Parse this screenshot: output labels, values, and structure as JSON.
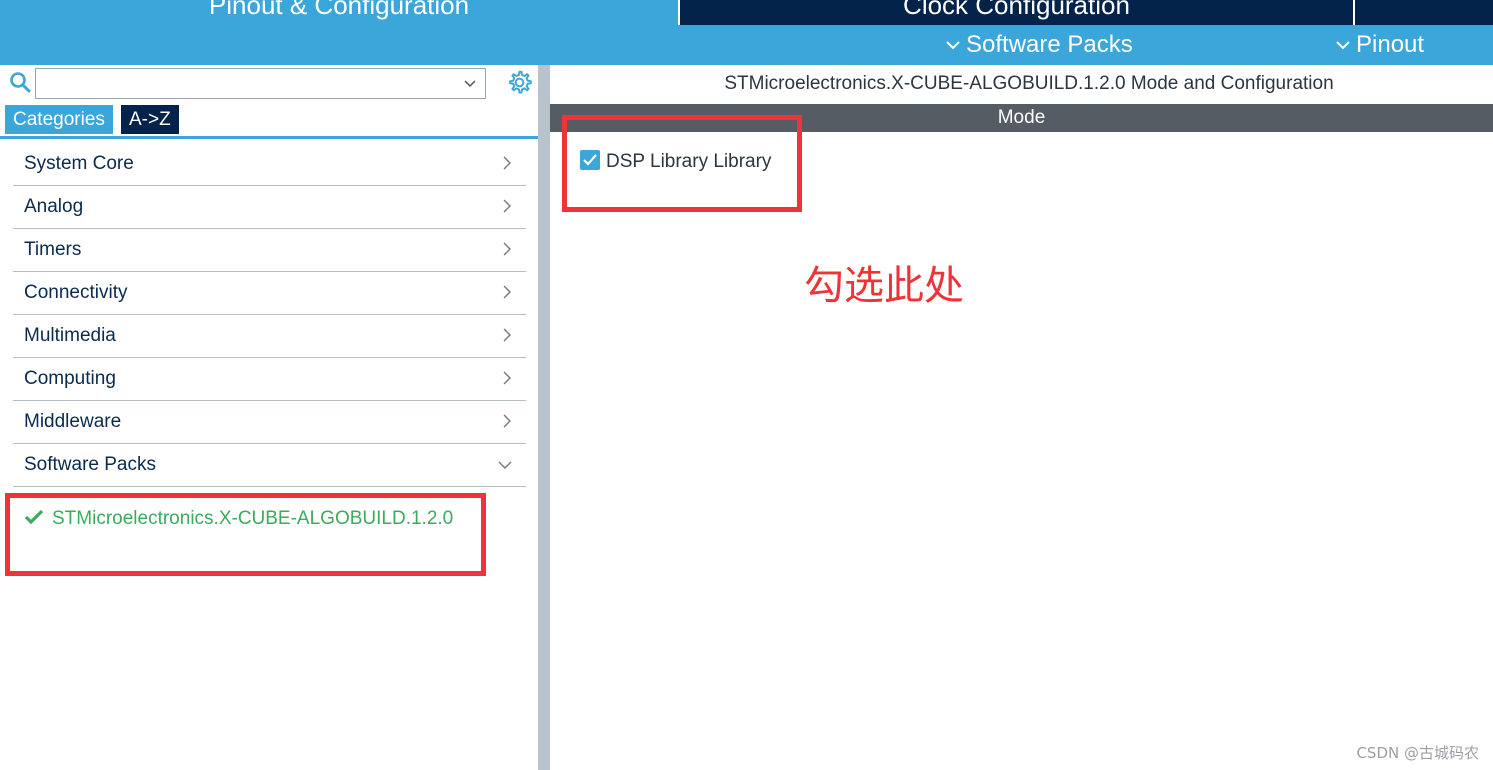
{
  "top_tabs": {
    "pinout_config": "Pinout & Configuration",
    "clock_config": "Clock Configuration"
  },
  "subbar": {
    "software_packs": "Software Packs",
    "pinout": "Pinout"
  },
  "search": {
    "value": "",
    "placeholder": ""
  },
  "category_tabs": {
    "categories": "Categories",
    "az": "A->Z"
  },
  "categories": [
    "System Core",
    "Analog",
    "Timers",
    "Connectivity",
    "Multimedia",
    "Computing",
    "Middleware",
    "Software Packs"
  ],
  "software_pack_item": "STMicroelectronics.X-CUBE-ALGOBUILD.1.2.0",
  "right_panel": {
    "title": "STMicroelectronics.X-CUBE-ALGOBUILD.1.2.0 Mode and Configuration",
    "mode_header": "Mode",
    "dsp_checkbox_label": "DSP Library Library",
    "dsp_checked": true
  },
  "annotation": "勾选此处",
  "watermark": "CSDN @古城码农",
  "colors": {
    "accent_blue": "#3aa6d9",
    "dark_navy": "#03234b",
    "success_green": "#3bab5d",
    "annotation_red": "#ee3439",
    "mode_header_gray": "#555c63"
  },
  "icons": [
    "search-icon",
    "gear-icon",
    "chevron-down-icon",
    "chevron-right-icon",
    "check-icon",
    "checkbox-checked-icon"
  ]
}
